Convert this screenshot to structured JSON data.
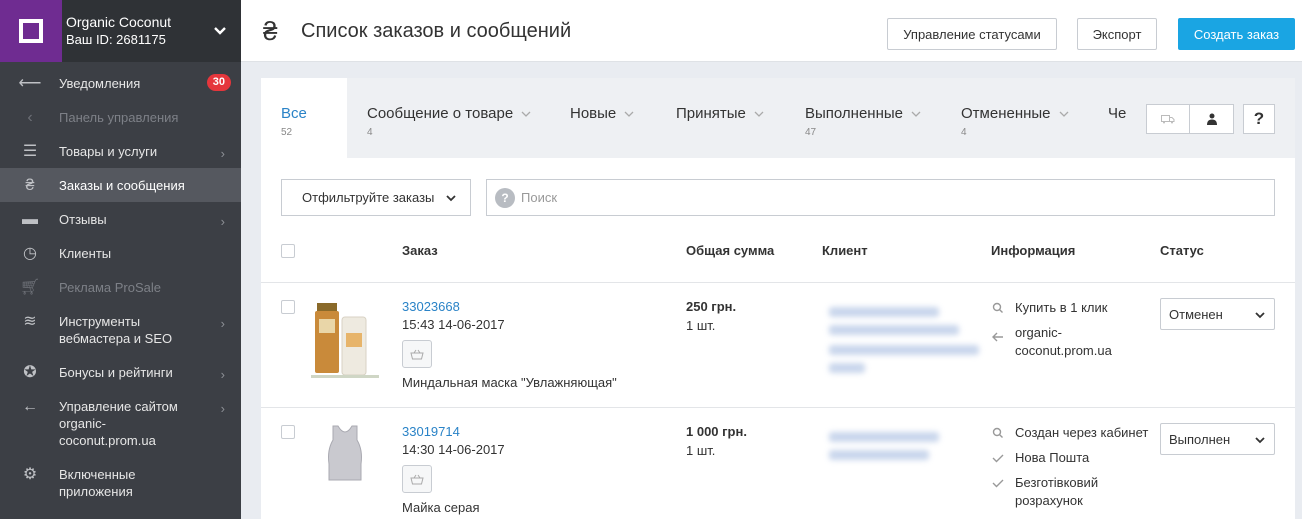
{
  "account": {
    "name": "Organic Coconut",
    "id_label": "Ваш ID: 2681175"
  },
  "sidebar": {
    "items": [
      {
        "label": "Уведомления",
        "icon": "arrow-left-icon",
        "badge": "30"
      },
      {
        "label": "Панель управления",
        "icon": "chevron-left-icon"
      },
      {
        "label": "Товары и услуги",
        "icon": "list-icon"
      },
      {
        "label": "Заказы и сообщения",
        "icon": "hryvnia-icon"
      },
      {
        "label": "Отзывы",
        "icon": "minus-icon"
      },
      {
        "label": "Клиенты",
        "icon": "clock-icon"
      },
      {
        "label": "Реклама ProSale",
        "icon": "cart-icon"
      },
      {
        "label": "Инструменты вебмастера и SEO",
        "icon": "wifi-icon"
      },
      {
        "label": "Бонусы и рейтинги",
        "icon": "award-icon"
      },
      {
        "label": "Управление сайтом organic-coconut.prom.ua",
        "icon": "arrow-back-icon"
      },
      {
        "label": "Включенные приложения",
        "icon": "gear-icon"
      }
    ]
  },
  "header": {
    "title": "Список заказов и сообщений",
    "currency_symbol": "₴",
    "btn_status": "Управление статусами",
    "btn_export": "Экспорт",
    "btn_create": "Создать заказ"
  },
  "tabs": [
    {
      "label": "Все",
      "count": "52"
    },
    {
      "label": "Сообщение о товаре",
      "count": "4"
    },
    {
      "label": "Новые",
      "count": ""
    },
    {
      "label": "Принятые",
      "count": ""
    },
    {
      "label": "Выполненные",
      "count": "47"
    },
    {
      "label": "Отмененные",
      "count": "4"
    },
    {
      "label": "Че",
      "count": ""
    }
  ],
  "help_label": "?",
  "filter": {
    "label": "Отфильтруйте заказы",
    "search_placeholder": "Поиск",
    "search_help": "?"
  },
  "table": {
    "headers": {
      "order": "Заказ",
      "sum": "Общая сумма",
      "client": "Клиент",
      "info": "Информация",
      "status": "Статус"
    },
    "rows": [
      {
        "order_id": "33023668",
        "time": "15:43 14-06-2017",
        "product": "Миндальная маска \"Увлажняющая\"",
        "sum": "250 грн.",
        "qty": "1 шт.",
        "info1": "Купить в 1 клик",
        "info2": "organic-coconut.prom.ua",
        "status": "Отменен"
      },
      {
        "order_id": "33019714",
        "time": "14:30 14-06-2017",
        "product": "Майка серая",
        "sum": "1 000 грн.",
        "qty": "1 шт.",
        "info1": "Создан через кабинет",
        "info2": "Нова Пошта",
        "info3": "Безготівковий розрахунок",
        "status": "Выполнен"
      }
    ]
  },
  "colors": {
    "accent": "#1aa5e3",
    "brand": "#6f2c91",
    "link": "#2a83c7",
    "badge": "#e5363c",
    "sidebar": "#3c3f45"
  }
}
